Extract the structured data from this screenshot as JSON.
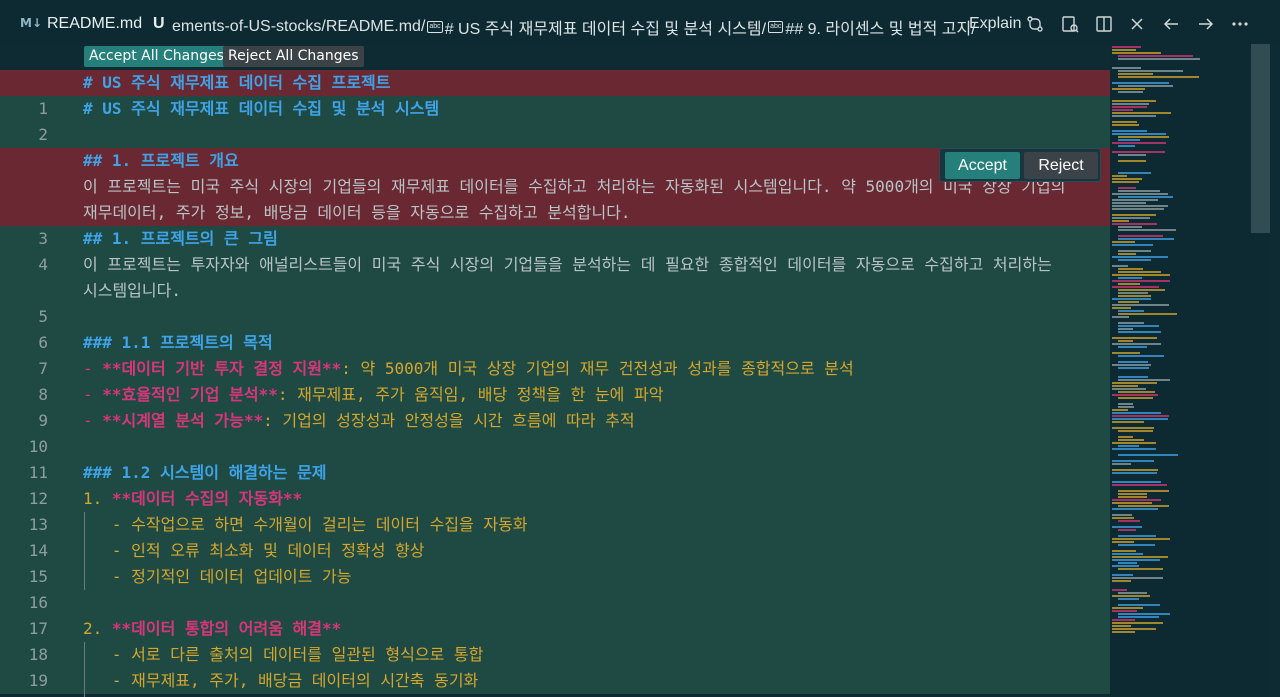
{
  "tab": {
    "icon_text": "M↓",
    "title": "README.md",
    "modified": "U"
  },
  "breadcrumb": {
    "part1": "ements-of-US-stocks/README.md/",
    "part2": "# US 주식 재무제표 데이터 수집 및 분석 시스템/",
    "part3": "## 9. 라이센스 및 법적 고지/",
    "abc_label": "abc"
  },
  "explain_label": "Explain",
  "icons": [
    "compare-changes-icon",
    "open-preview-icon",
    "split-editor-icon",
    "close-icon",
    "back-arrow-icon",
    "forward-arrow-icon",
    "more-actions-icon"
  ],
  "actions": {
    "accept_all": "Accept All Changes",
    "reject_all": "Reject All Changes"
  },
  "widget": {
    "accept": "Accept",
    "reject": "Reject"
  },
  "editor": {
    "deleted_1": "# US 주식 재무제표 데이터 수집 프로젝트",
    "deleted_2": "## 1. 프로젝트 개요",
    "deleted_3": "이 프로젝트는 미국 주식 시장의 기업들의 재무제표 데이터를 수집하고 처리하는 자동화된 시스템입니다. 약 5000개의 미국 상장 기업의",
    "deleted_4": "재무데이터, 주가 정보, 배당금 데이터 등을 자동으로 수집하고 분석합니다.",
    "lines": [
      {
        "num": "1",
        "text": "# US 주식 재무제표 데이터 수집 및 분석 시스템"
      },
      {
        "num": "2",
        "text": ""
      },
      {
        "num": "3",
        "text": "## 1. 프로젝트의 큰 그림"
      },
      {
        "num": "4",
        "text": "이 프로젝트는 투자자와 애널리스트들이 미국 주식 시장의 기업들을 분석하는 데 필요한 종합적인 데이터를 자동으로 수집하고 처리하는"
      },
      {
        "num": "",
        "text": "시스템입니다."
      },
      {
        "num": "5",
        "text": ""
      },
      {
        "num": "6",
        "text": "### 1.1 프로젝트의 목적"
      },
      {
        "num": "7",
        "bullet": "- ",
        "bold": "**데이터 기반 투자 결정 지원**",
        "rest": ": 약 5000개 미국 상장 기업의 재무 건전성과 성과를 종합적으로 분석"
      },
      {
        "num": "8",
        "bullet": "- ",
        "bold": "**효율적인 기업 분석**",
        "rest": ": 재무제표, 주가 움직임, 배당 정책을 한 눈에 파악"
      },
      {
        "num": "9",
        "bullet": "- ",
        "bold": "**시계열 분석 가능**",
        "rest": ": 기업의 성장성과 안정성을 시간 흐름에 따라 추적"
      },
      {
        "num": "10",
        "text": ""
      },
      {
        "num": "11",
        "text": "### 1.2 시스템이 해결하는 문제"
      },
      {
        "num": "12",
        "prefix": "1. ",
        "bold": "**데이터 수집의 자동화**"
      },
      {
        "num": "13",
        "text": "   - 수작업으로 하면 수개월이 걸리는 데이터 수집을 자동화"
      },
      {
        "num": "14",
        "text": "   - 인적 오류 최소화 및 데이터 정확성 향상"
      },
      {
        "num": "15",
        "text": "   - 정기적인 데이터 업데이트 가능"
      },
      {
        "num": "16",
        "text": ""
      },
      {
        "num": "17",
        "prefix": "2. ",
        "bold": "**데이터 통합의 어려움 해결**"
      },
      {
        "num": "18",
        "text": "   - 서로 다른 출처의 데이터를 일관된 형식으로 통합"
      },
      {
        "num": "19",
        "text": "   - 재무제표, 주가, 배당금 데이터의 시간축 동기화"
      }
    ]
  }
}
